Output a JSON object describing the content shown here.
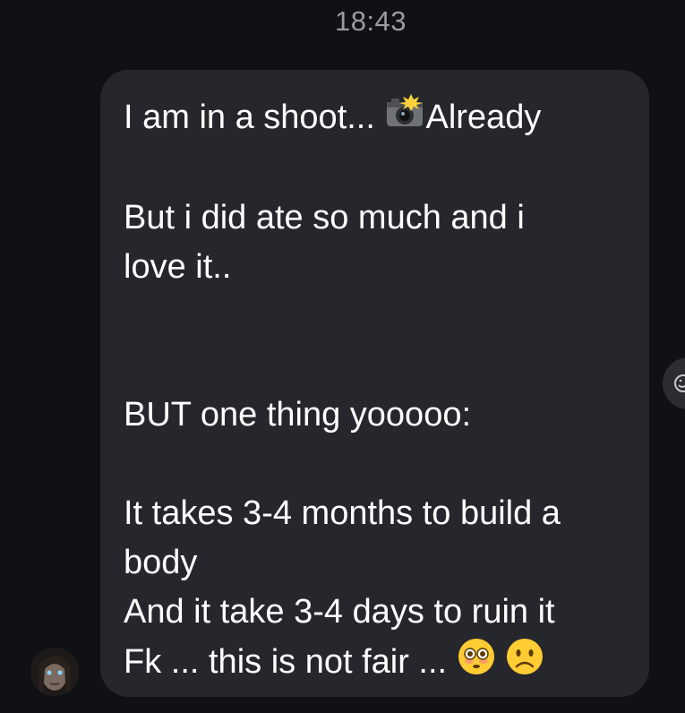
{
  "header": {
    "timestamp": "18:43"
  },
  "message": {
    "lines": [
      {
        "text": "I am in a shoot... ",
        "emoji_after": "camera-flash-emoji",
        "text_after": "Already"
      },
      {
        "text": ""
      },
      {
        "text": "But i did ate so much and i"
      },
      {
        "text": "love it.."
      },
      {
        "text": ""
      },
      {
        "text": ""
      },
      {
        "text": "BUT one thing yooooo:"
      },
      {
        "text": ""
      },
      {
        "text": "It takes 3-4 months to build a"
      },
      {
        "text": "body"
      },
      {
        "text": "And it take 3-4 days to ruin it"
      },
      {
        "text": "Fk ... this is not fair ... ",
        "emoji_after": "flushed-face-emoji",
        "emoji_after_2": "slightly-frowning-face-emoji"
      }
    ],
    "bubble_color": "#25272c",
    "text_color": "#ffffff"
  },
  "colors": {
    "background": "#0f1115",
    "timestamp": "#9a9ca2"
  }
}
